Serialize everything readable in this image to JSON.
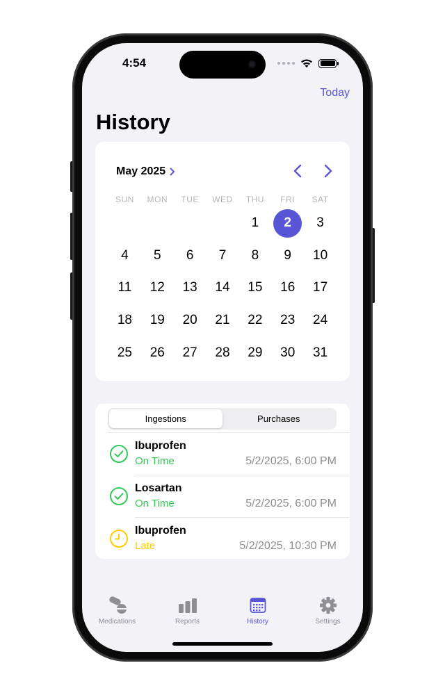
{
  "status_bar": {
    "time": "4:54"
  },
  "header": {
    "today_label": "Today",
    "title": "History"
  },
  "calendar": {
    "month_label": "May 2025",
    "weekdays": [
      "SUN",
      "MON",
      "TUE",
      "WED",
      "THU",
      "FRI",
      "SAT"
    ],
    "days": [
      "",
      "",
      "",
      "",
      "1",
      "2",
      "3",
      "4",
      "5",
      "6",
      "7",
      "8",
      "9",
      "10",
      "11",
      "12",
      "13",
      "14",
      "15",
      "16",
      "17",
      "18",
      "19",
      "20",
      "21",
      "22",
      "23",
      "24",
      "25",
      "26",
      "27",
      "28",
      "29",
      "30",
      "31"
    ],
    "selected_day": "2"
  },
  "segments": {
    "items": [
      "Ingestions",
      "Purchases"
    ],
    "selected": "Ingestions"
  },
  "entries": [
    {
      "name": "Ibuprofen",
      "status": "On Time",
      "status_kind": "on-time",
      "time": "5/2/2025, 6:00 PM",
      "icon": "checkmark-circle-icon"
    },
    {
      "name": "Losartan",
      "status": "On Time",
      "status_kind": "on-time",
      "time": "5/2/2025, 6:00 PM",
      "icon": "checkmark-circle-icon"
    },
    {
      "name": "Ibuprofen",
      "status": "Late",
      "status_kind": "late",
      "time": "5/2/2025, 10:30 PM",
      "icon": "clock-icon"
    }
  ],
  "tabs": [
    {
      "label": "Medications",
      "icon": "pills-icon",
      "active": false
    },
    {
      "label": "Reports",
      "icon": "bar-chart-icon",
      "active": false
    },
    {
      "label": "History",
      "icon": "calendar-icon",
      "active": true
    },
    {
      "label": "Settings",
      "icon": "gear-icon",
      "active": false
    }
  ],
  "colors": {
    "accent": "#5856d6",
    "on_time": "#34c759",
    "late": "#ffcc00",
    "muted": "#8e8e93"
  }
}
